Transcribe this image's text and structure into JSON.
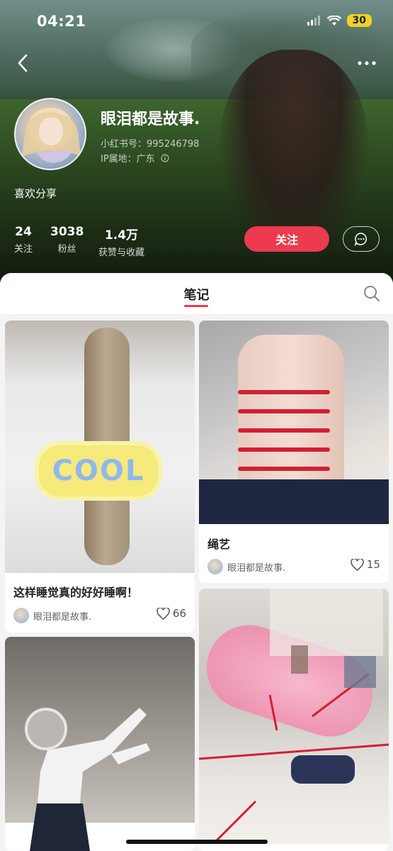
{
  "status_bar": {
    "time": "04:21",
    "battery": "30",
    "icons": [
      "signal-icon",
      "wifi-icon",
      "battery-icon"
    ]
  },
  "nav": {
    "back_icon": "chevron-left-icon",
    "more_icon": "more-horizontal-icon"
  },
  "profile": {
    "username": "眼泪都是故事.",
    "account_id": "小红书号：995246798",
    "ip_location": "IP属地：广东",
    "ip_info_icon": "info-icon",
    "bio": "喜欢分享",
    "stats": [
      {
        "value": "24",
        "label": "关注"
      },
      {
        "value": "3038",
        "label": "粉丝"
      },
      {
        "value": "1.4万",
        "label": "获赞与收藏"
      }
    ],
    "follow_label": "关注",
    "chat_icon": "message-icon"
  },
  "tabs": {
    "active": "笔记",
    "search_icon": "search-icon"
  },
  "notes": [
    {
      "title": "这样睡觉真的好好睡啊！",
      "author": "眼泪都是故事.",
      "likes": "66",
      "badge": "COOL"
    },
    {
      "title": "绳艺",
      "author": "眼泪都是故事.",
      "likes": "15"
    },
    {
      "title": "",
      "author": "",
      "likes": ""
    },
    {
      "title": "",
      "author": "",
      "likes": ""
    }
  ],
  "colors": {
    "accent": "#ec3a4f",
    "battery": "#f1d028"
  }
}
